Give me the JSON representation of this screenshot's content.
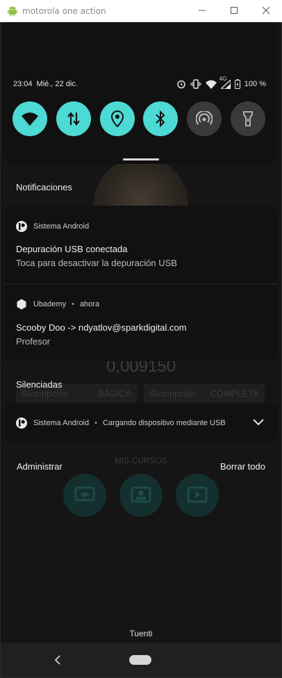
{
  "window": {
    "title": "motorola one action",
    "icon": "android-icon",
    "buttons": [
      "minimize-icon",
      "maximize-icon",
      "close-icon"
    ]
  },
  "status_bar": {
    "time": "23:04",
    "date": "Mié., 22 dic.",
    "network_type": "4G",
    "battery": "100 %",
    "icons": [
      "alarm-icon",
      "vibrate-icon",
      "wifi-icon",
      "signal-icon",
      "battery-icon"
    ]
  },
  "quick_settings": [
    {
      "name": "wifi",
      "icon": "wifi-icon",
      "active": true
    },
    {
      "name": "mobile-data",
      "icon": "data-arrows-icon",
      "active": true
    },
    {
      "name": "location",
      "icon": "location-pin-icon",
      "active": true
    },
    {
      "name": "bluetooth",
      "icon": "bluetooth-icon",
      "active": true
    },
    {
      "name": "hotspot",
      "icon": "hotspot-icon",
      "active": false
    },
    {
      "name": "flashlight",
      "icon": "flashlight-icon",
      "active": false
    }
  ],
  "colors": {
    "accent": "#4dd9d4",
    "card_bg": "#111111",
    "inactive_tile": "#3a3a3a"
  },
  "notifications_header": "Notificaciones",
  "notifications": [
    {
      "app": "Sistema Android",
      "app_icon": "android-system-icon",
      "title": "Depuración USB conectada",
      "text": "Toca para desactivar la depuración USB"
    },
    {
      "app": "Ubademy",
      "time": "ahora",
      "app_icon": "hexagon-app-icon",
      "title": "Scooby Doo -> ndyatlov@sparkdigital.com",
      "text": "Profesor"
    }
  ],
  "silenced_header": "Silenciadas",
  "silenced": {
    "app": "Sistema Android",
    "text": "Cargando dispositivo mediante USB",
    "expand_icon": "chevron-down-icon"
  },
  "actions": {
    "manage": "Administrar",
    "clear_all": "Borrar todo"
  },
  "background_app": {
    "balance": "0,009150",
    "subscriptions": [
      {
        "label": "Suscripción",
        "tier": "BÁSICA"
      },
      {
        "label": "Suscripción",
        "tier": "COMPLETA"
      }
    ],
    "section": "MIS CURSOS",
    "buttons": [
      "course-cast-icon",
      "course-teacher-icon",
      "course-play-icon"
    ]
  },
  "carrier": "Tuenti",
  "nav": [
    "back-icon",
    "home-pill"
  ]
}
